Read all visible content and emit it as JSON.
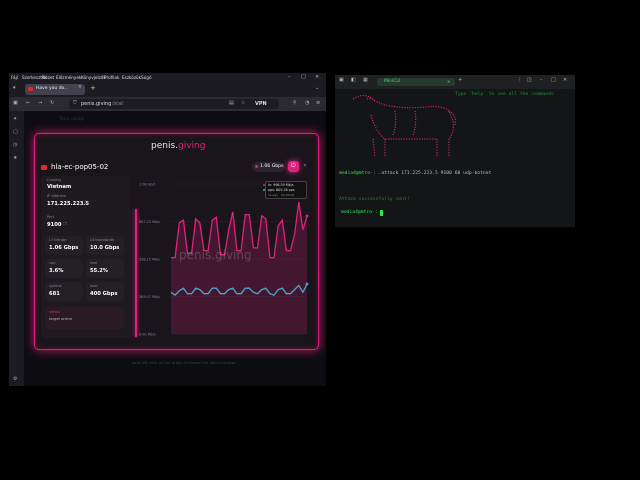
{
  "browser": {
    "menu": [
      "Fájl",
      "Szerkesztés",
      "Nézet",
      "Előzmények",
      "Könyvjelzők",
      "Profilok",
      "Eszközök",
      "Súgó"
    ],
    "tab_title": "Have you do..",
    "url_domain": "penis.giving",
    "url_path": "/stat",
    "vpn_label": "VPN",
    "page_heading": "Total usage"
  },
  "panel": {
    "brand_a": "penis.",
    "brand_b": "giving",
    "server_name": "hla-ec-pop05-02",
    "speed_badge": "1.06 Gbps",
    "country_label": "Country",
    "country": "Vietnam",
    "ip_label": "IP Address",
    "ip": "171.225.223.5",
    "port_label": "Port",
    "port": "9100",
    "bitrate_label": "L7 bitrate",
    "bitrate": "1.06 Gbps",
    "bandwidth_label": "L4 bandwidth",
    "bandwidth": "10.0 Gbps",
    "cpu_label": "cpu",
    "cpu": "3.6%",
    "ram_label": "ram",
    "ram": "55.2%",
    "uptime_label": "uptime",
    "uptime": "681",
    "user_label": "user",
    "user": "400 Gbps",
    "status_label": "status",
    "status_text": "target online",
    "watermark": "penis.giving",
    "hint": "hold left click on the graph to freeze the load indicator"
  },
  "tooltip": {
    "in": "In: 996.59 Mb/s",
    "pps": "pps: 605.26 pps",
    "ago": "1s ago · 02:03:09"
  },
  "chart_data": {
    "type": "line",
    "y_ticks": [
      "1.08 Gb/s",
      "807.23 Mb/s",
      "538.15 Mb/s",
      "269.07 Mb/s",
      "0.00 Mb/s"
    ],
    "ylim": [
      0,
      1.08
    ],
    "series": [
      {
        "name": "In",
        "color": "#e0207e",
        "values": [
          0.55,
          0.55,
          0.8,
          0.82,
          0.58,
          0.58,
          0.83,
          0.8,
          0.6,
          0.6,
          0.82,
          0.84,
          0.57,
          0.57,
          0.75,
          0.88,
          0.6,
          0.6,
          0.86,
          0.86,
          0.62,
          0.62,
          0.85,
          0.83,
          0.55,
          0.55,
          0.78,
          0.82,
          0.6,
          0.6,
          0.72,
          0.95,
          0.75,
          0.85
        ]
      },
      {
        "name": "pps",
        "color": "#4aa7c6",
        "values": [
          0.3,
          0.28,
          0.31,
          0.33,
          0.29,
          0.29,
          0.33,
          0.32,
          0.29,
          0.29,
          0.33,
          0.33,
          0.29,
          0.29,
          0.32,
          0.33,
          0.29,
          0.29,
          0.33,
          0.33,
          0.3,
          0.29,
          0.32,
          0.33,
          0.29,
          0.28,
          0.32,
          0.33,
          0.29,
          0.29,
          0.32,
          0.35,
          0.3,
          0.36
        ]
      }
    ]
  },
  "terminal": {
    "tab_label": "MiniCLI",
    "help_text": "Type 'help' to see all the commands",
    "prompt1": "media4@mtro-:",
    "command": " .attack 171.225.223.5 9100 60 udp-botnet",
    "result": "Attack successfully sent!",
    "prompt2": "media4@mtro-:"
  },
  "colors": {
    "accent": "#e0207e",
    "terminal_green": "#2de05a",
    "terminal_dim": "#1f8a3e",
    "ascii_pink": "#c62a64"
  }
}
